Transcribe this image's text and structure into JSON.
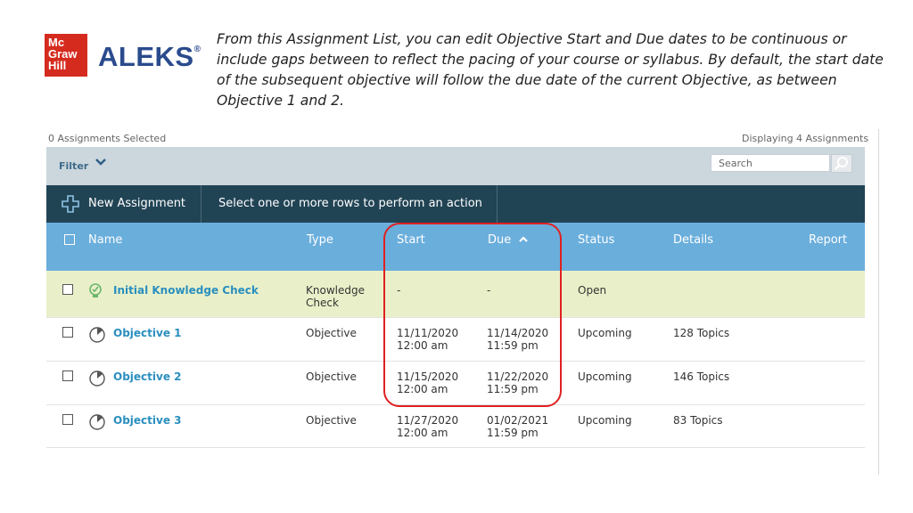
{
  "logos": {
    "mgh": [
      "Mc",
      "Graw",
      "Hill"
    ],
    "aleks": "ALEKS",
    "aleks_reg": "®"
  },
  "caption": "From this Assignment List, you can edit Objective Start and Due dates to be continuous or include gaps between to reflect the pacing of your course or syllabus. By default, the start date of the subsequent objective will follow the due date of the current Objective, as between Objective 1 and 2.",
  "meta": {
    "selected": "0 Assignments Selected",
    "displaying": "Displaying 4 Assignments"
  },
  "filter": {
    "label": "Filter",
    "search_placeholder": "Search"
  },
  "actions": {
    "new_assignment": "New Assignment",
    "message": "Select one or more rows to perform an action"
  },
  "columns": {
    "name": "Name",
    "type": "Type",
    "start": "Start",
    "due": "Due",
    "status": "Status",
    "details": "Details",
    "report": "Report"
  },
  "colors": {
    "header": "#6aaedc",
    "actionbar": "#214455",
    "filterbar": "#ccd6dd",
    "kc_row": "#e9f0c9",
    "link": "#2a8fbf",
    "highlight": "#e02020"
  },
  "rows": [
    {
      "icon": "knowledge-check-icon",
      "name": "Initial Knowledge Check",
      "type": [
        "Knowledge",
        "Check"
      ],
      "start": [
        "-",
        ""
      ],
      "due": [
        "-",
        ""
      ],
      "status": "Open",
      "details": ""
    },
    {
      "icon": "objective-clock-icon",
      "name": "Objective 1",
      "type": [
        "Objective",
        ""
      ],
      "start": [
        "11/11/2020",
        "12:00 am"
      ],
      "due": [
        "11/14/2020",
        "11:59 pm"
      ],
      "status": "Upcoming",
      "details": "128 Topics"
    },
    {
      "icon": "objective-clock-icon",
      "name": "Objective 2",
      "type": [
        "Objective",
        ""
      ],
      "start": [
        "11/15/2020",
        "12:00 am"
      ],
      "due": [
        "11/22/2020",
        "11:59 pm"
      ],
      "status": "Upcoming",
      "details": "146 Topics"
    },
    {
      "icon": "objective-clock-icon",
      "name": "Objective 3",
      "type": [
        "Objective",
        ""
      ],
      "start": [
        "11/27/2020",
        "12:00 am"
      ],
      "due": [
        "01/02/2021",
        "11:59 pm"
      ],
      "status": "Upcoming",
      "details": "83 Topics"
    }
  ]
}
